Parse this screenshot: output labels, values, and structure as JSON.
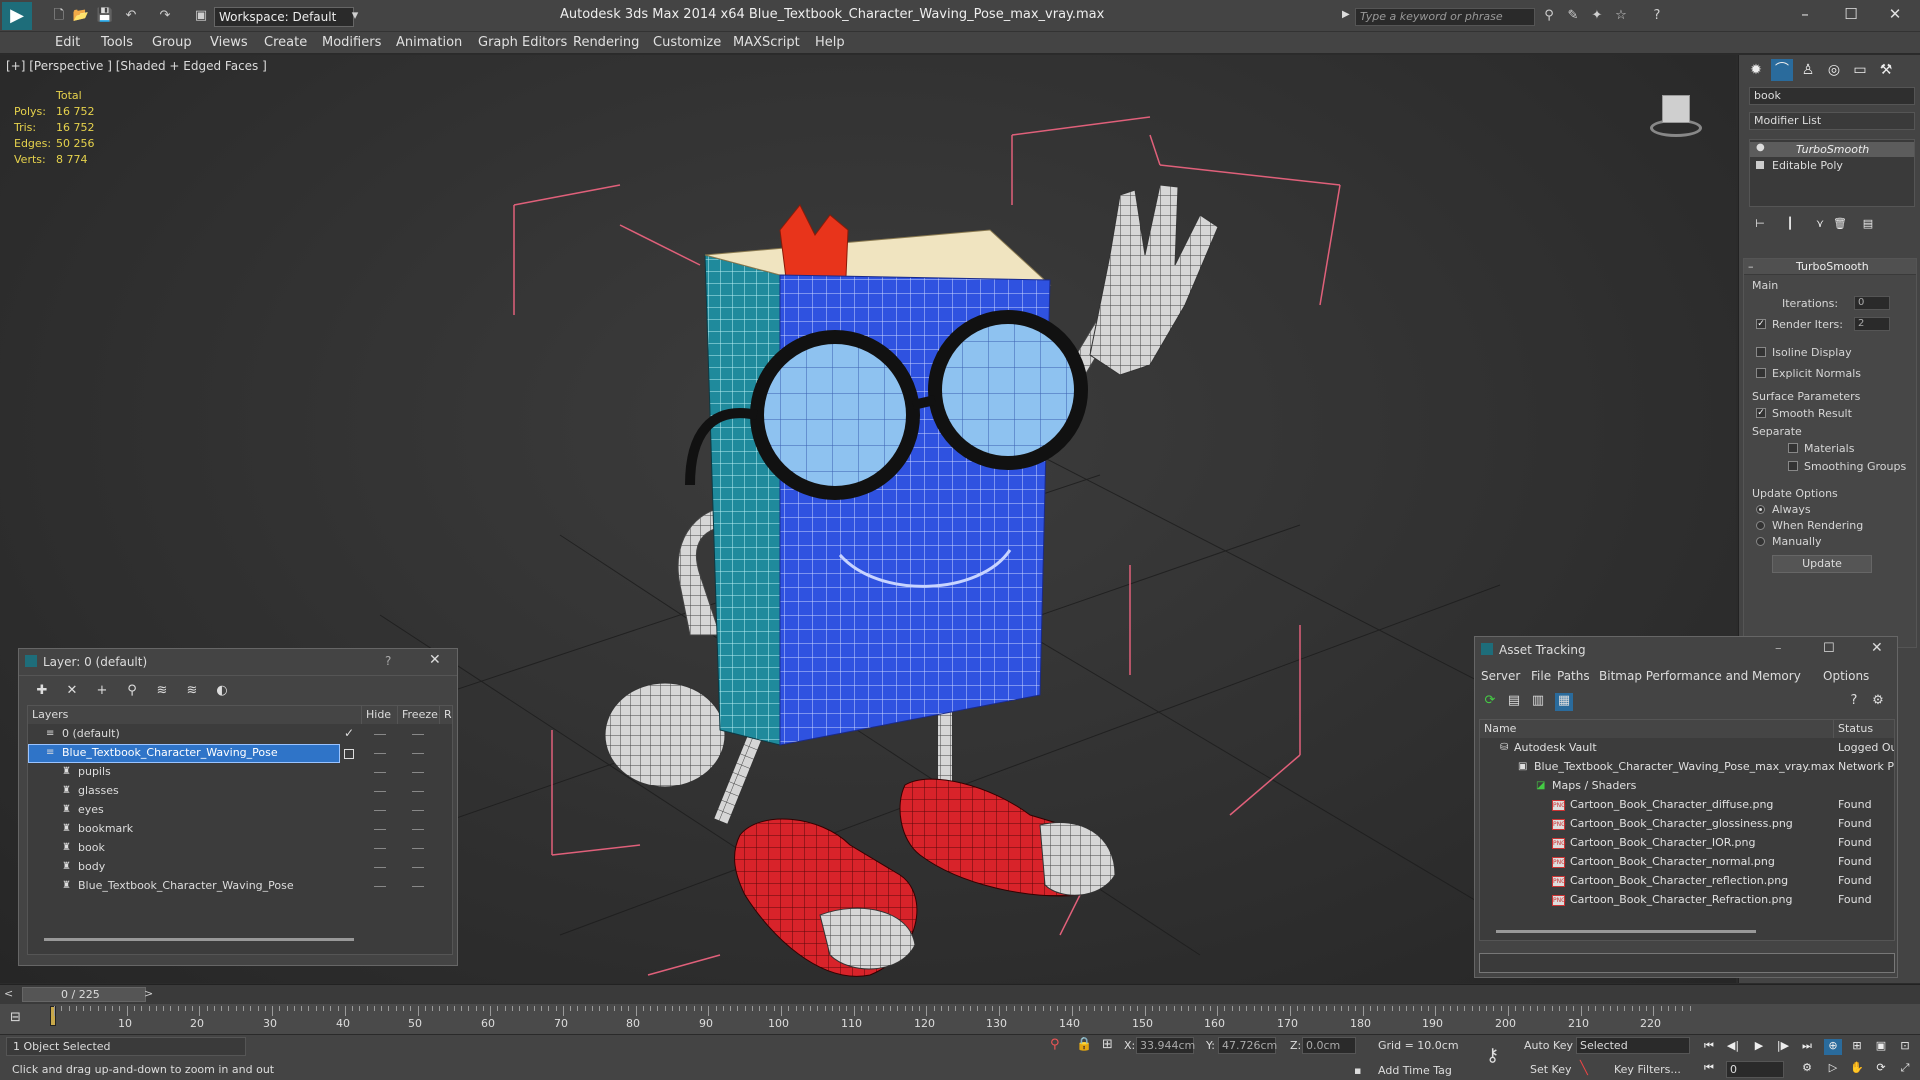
{
  "app": {
    "title": "Autodesk 3ds Max  2014 x64     Blue_Textbook_Character_Waving_Pose_max_vray.max",
    "workspace": "Workspace: Default",
    "search_placeholder": "Type a keyword or phrase"
  },
  "menu": [
    "Edit",
    "Tools",
    "Group",
    "Views",
    "Create",
    "Modifiers",
    "Animation",
    "Graph Editors",
    "Rendering",
    "Customize",
    "MAXScript",
    "Help"
  ],
  "viewport": {
    "label": "[+] [Perspective ] [Shaded + Edged Faces ]",
    "stats": {
      "header": "Total",
      "rows": [
        {
          "label": "Polys:",
          "value": "16 752"
        },
        {
          "label": "Tris:",
          "value": "16 752"
        },
        {
          "label": "Edges:",
          "value": "50 256"
        },
        {
          "label": "Verts:",
          "value": "8 774"
        }
      ]
    },
    "colors": {
      "book_blue": "#2f52e0",
      "spine_teal": "#1f8a9c",
      "lens": "#8ec2f0",
      "shoe_red": "#d8232a",
      "bookmark": "#e8341b",
      "bbox": "#e0607a"
    }
  },
  "command_panel": {
    "name_field": "book",
    "modifier_list": "Modifier List",
    "stack": [
      "TurboSmooth",
      "Editable Poly"
    ],
    "rollout_title": "TurboSmooth",
    "main_label": "Main",
    "iterations_label": "Iterations:",
    "iterations_value": "0",
    "render_iters_label": "Render Iters:",
    "render_iters_value": "2",
    "isoline": "Isoline Display",
    "explicit_normals": "Explicit Normals",
    "surface_params": "Surface Parameters",
    "smooth_result": "Smooth Result",
    "separate": "Separate",
    "materials": "Materials",
    "smoothing_groups": "Smoothing Groups",
    "update_options": "Update Options",
    "always": "Always",
    "when_rendering": "When Rendering",
    "manually": "Manually",
    "update_btn": "Update"
  },
  "layer_panel": {
    "title": "Layer: 0 (default)",
    "help": "?",
    "columns": {
      "layers": "Layers",
      "hide": "Hide",
      "freeze": "Freeze",
      "r": "R"
    },
    "rows": [
      {
        "name": "0 (default)"
      },
      {
        "name": "Blue_Textbook_Character_Waving_Pose"
      },
      {
        "name": "pupils"
      },
      {
        "name": "glasses"
      },
      {
        "name": "eyes"
      },
      {
        "name": "bookmark"
      },
      {
        "name": "book"
      },
      {
        "name": "body"
      },
      {
        "name": "Blue_Textbook_Character_Waving_Pose"
      }
    ]
  },
  "asset_panel": {
    "title": "Asset Tracking",
    "menu": [
      "Server",
      "File",
      "Paths",
      "Bitmap Performance and Memory",
      "Options"
    ],
    "columns": {
      "name": "Name",
      "status": "Status"
    },
    "rows": [
      {
        "name": "Autodesk Vault",
        "status": "Logged Ou"
      },
      {
        "name": "Blue_Textbook_Character_Waving_Pose_max_vray.max",
        "status": "Network Pa"
      },
      {
        "name": "Maps / Shaders",
        "status": ""
      },
      {
        "name": "Cartoon_Book_Character_diffuse.png",
        "status": "Found"
      },
      {
        "name": "Cartoon_Book_Character_glossiness.png",
        "status": "Found"
      },
      {
        "name": "Cartoon_Book_Character_IOR.png",
        "status": "Found"
      },
      {
        "name": "Cartoon_Book_Character_normal.png",
        "status": "Found"
      },
      {
        "name": "Cartoon_Book_Character_reflection.png",
        "status": "Found"
      },
      {
        "name": "Cartoon_Book_Character_Refraction.png",
        "status": "Found"
      }
    ]
  },
  "timeline": {
    "frame": "0 / 225",
    "ticks": [
      "10",
      "20",
      "30",
      "40",
      "50",
      "60",
      "70",
      "80",
      "90",
      "100",
      "110",
      "120",
      "130",
      "140",
      "150",
      "160",
      "170",
      "180",
      "190",
      "200",
      "210",
      "220"
    ]
  },
  "status": {
    "selected": "1 Object Selected",
    "prompt": "Click and drag up-and-down to zoom in and out",
    "x_label": "X:",
    "x_value": "33.944cm",
    "y_label": "Y:",
    "y_value": "47.726cm",
    "z_label": "Z:",
    "z_value": "0.0cm",
    "grid": "Grid = 10.0cm",
    "add_time_tag": "Add Time Tag",
    "auto_key": "Auto Key",
    "set_key": "Set Key",
    "selected_dropdown": "Selected",
    "key_filters": "Key Filters...",
    "current_frame": "0"
  }
}
